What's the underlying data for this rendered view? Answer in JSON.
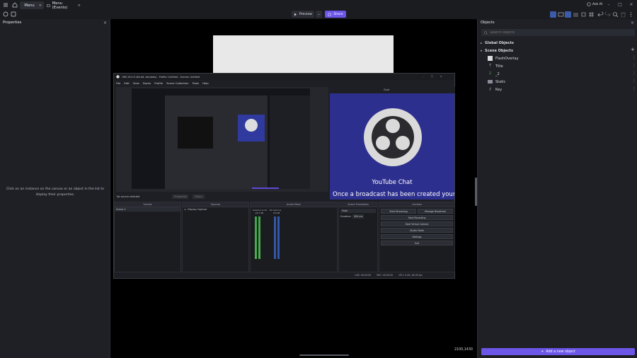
{
  "tabs": [
    {
      "label": "Menu",
      "icon": "menu-icon"
    },
    {
      "label": "Menu (Events)",
      "icon": "events-icon"
    }
  ],
  "top_right": {
    "ask_ai_label": "Ask AI"
  },
  "toolbar": {
    "preview_label": "Preview",
    "share_label": "Share"
  },
  "properties": {
    "title": "Properties",
    "empty_message": "Click on an instance on the canvas or an object in the list to display their properties."
  },
  "canvas": {
    "coordinates": "2100,1430"
  },
  "objects_panel": {
    "title": "Objects",
    "search_placeholder": "Search objects",
    "global_objects_label": "Global Objects",
    "scene_objects_label": "Scene Objects",
    "items": [
      {
        "name": "FlashOverlay",
        "icon": "sprite-icon"
      },
      {
        "name": "Title",
        "icon": "text-icon"
      },
      {
        "name": "_2",
        "icon": "number-icon"
      },
      {
        "name": "Static",
        "icon": "tilemap-icon"
      },
      {
        "name": "Key",
        "icon": "key-icon"
      }
    ],
    "add_button_label": "Add a new object"
  },
  "obs": {
    "window_title": "OBS 28.0.0 (64-bit, windows) - Profile: Untitled - Scenes: Untitled",
    "menu": [
      "File",
      "Edit",
      "View",
      "Docks",
      "Profile",
      "Scene Collection",
      "Tools",
      "Help"
    ],
    "chat_title": "Chat",
    "youtube_chat_label": "YouTube Chat",
    "broadcast_text": "Once a broadcast has been created your live",
    "no_source_label": "No source selected",
    "properties_btn": "Properties",
    "filters_btn": "Filters",
    "docks": {
      "scenes": "Scenes",
      "sources": "Sources",
      "audio_mixer": "Audio Mixer",
      "scene_transitions": "Scene Transitions",
      "controls": "Controls"
    },
    "scene_item": "Scene 2",
    "source_item": "Display Capture",
    "audio_channels": [
      {
        "name": "Desktop Audio",
        "db": "-16.7 dB"
      },
      {
        "name": "Microphone",
        "db": "0.0 dB"
      }
    ],
    "transition": {
      "type": "Fade",
      "duration_label": "Duration",
      "duration_value": "300 ms"
    },
    "controls": {
      "start_streaming": "Start Streaming",
      "manage_broadcast": "Manage Broadcast",
      "start_recording": "Start Recording",
      "start_virtual_camera": "Start Virtual Camera",
      "studio_mode": "Studio Mode",
      "settings": "Settings",
      "exit": "Exit"
    },
    "status": {
      "live": "LIVE: 00:00:00",
      "rec": "REC: 00:00:00",
      "cpu": "CPU: 0.4%, 60.00 fps"
    }
  }
}
